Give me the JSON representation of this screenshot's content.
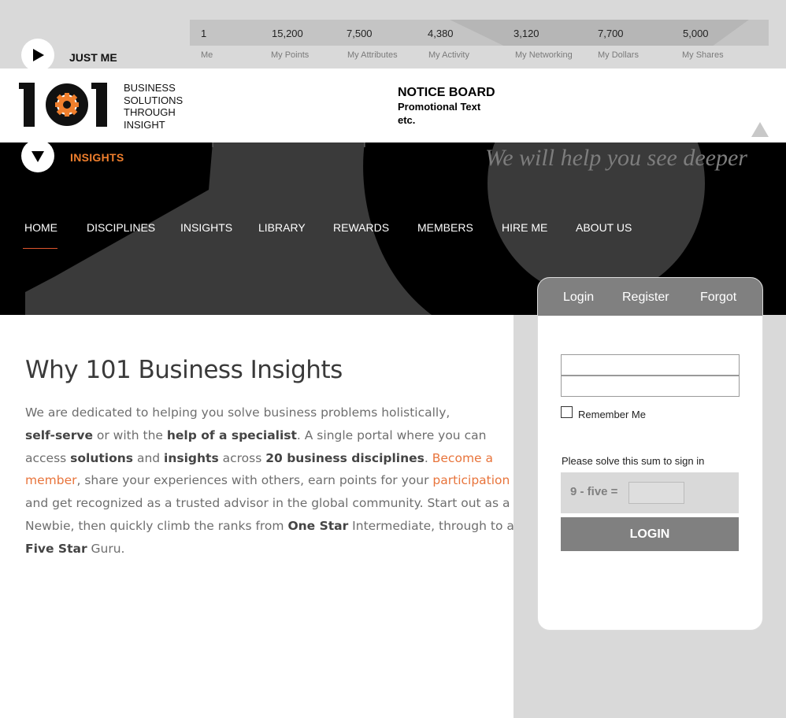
{
  "stats": [
    {
      "value": "1",
      "label": "Me"
    },
    {
      "value": "15,200",
      "label": "My Points"
    },
    {
      "value": "7,500",
      "label": "My Attributes"
    },
    {
      "value": "4,380",
      "label": "My Activity"
    },
    {
      "value": "3,120",
      "label": "My Networking"
    },
    {
      "value": "7,700",
      "label": "My Dollars"
    },
    {
      "value": "5,000",
      "label": "My Shares"
    }
  ],
  "user_toggle": {
    "label": "JUST ME"
  },
  "logo": {
    "text": "101",
    "tagline": [
      "BUSINESS",
      "SOLUTIONS",
      "THROUGH",
      "INSIGHT"
    ]
  },
  "notice": {
    "title": "NOTICE BOARD",
    "line1": "Promotional Text",
    "line2": "etc."
  },
  "section_toggle": {
    "label": "INSIGHTS"
  },
  "slogan": "We will help you see deeper",
  "nav": [
    "HOME",
    "DISCIPLINES",
    "INSIGHTS",
    "LIBRARY",
    "REWARDS",
    "MEMBERS",
    "HIRE ME",
    "ABOUT US"
  ],
  "main": {
    "title": "Why 101 Business Insights",
    "p": {
      "l1": "We are dedicated to helping you solve business problems holistically,",
      "l2a": "self-serve",
      "l2b": " or with the ",
      "l2c": "help of a specialist",
      "l2d": ". A single portal where you can",
      "l3a": "access ",
      "l3b": "solutions",
      "l3c": " and ",
      "l3d": "insights",
      "l3e": " across ",
      "l3f": "20 business disciplines",
      "l3g": ". ",
      "l3h": "Become a",
      "l4a": "member",
      "l4b": ", share your experiences with others, earn points for your ",
      "l4c": "participation",
      "l5": "and get recognized as a trusted advisor in the global community. Start out as a",
      "l6a": "Newbie, then quickly climb the ranks from ",
      "l6b": "One Star",
      "l6c": " Intermediate, through to a",
      "l7a": "Five Star",
      "l7b": " Guru."
    }
  },
  "login": {
    "tabs": [
      "Login",
      "Register",
      "Forgot"
    ],
    "remember_label": "Remember Me",
    "solve_label": "Please solve this sum to sign in",
    "captcha_question": "9 - five =",
    "button_label": "LOGIN"
  },
  "colors": {
    "accent_orange": "#f07f2d",
    "panel_gray": "#808080",
    "banner_black": "#000000",
    "bg_gray": "#d9d9d9"
  }
}
